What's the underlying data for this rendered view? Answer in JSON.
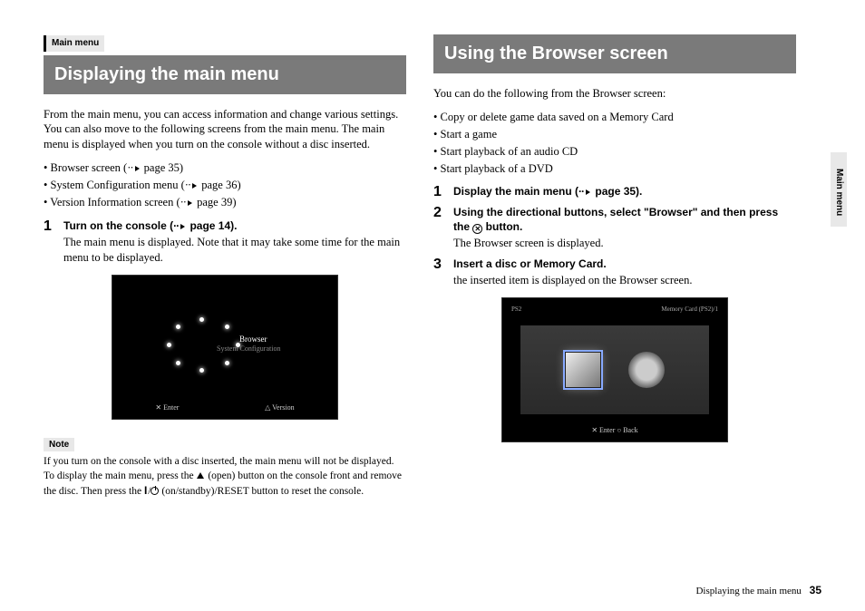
{
  "sideTabLabel": "Main menu",
  "left": {
    "sectionTag": "Main menu",
    "title": "Displaying the main menu",
    "intro": "From the main menu, you can access information and change various settings. You can also move to the following screens from the main menu. The main menu is displayed when you turn on the console without a disc inserted.",
    "bullets": [
      "Browser screen (  page 35)",
      "System Configuration menu (  page 36)",
      "Version Information screen (  page 39)"
    ],
    "steps": [
      {
        "num": "1",
        "title": "Turn on the console (  page 14).",
        "body": "The main menu is displayed. Note that it may take some time for the main menu to be displayed."
      }
    ],
    "shot": {
      "menuA": "Browser",
      "menuB": "System Configuration",
      "enter": "✕ Enter",
      "version": "△ Version"
    },
    "noteTag": "Note",
    "noteA": "If you turn on the console with a disc inserted, the main menu will not be displayed. To display the main menu, press the ",
    "noteB": " (open) button on the console front and remove the disc. Then press the ",
    "noteC": " (on/standby)/RESET button to reset the console."
  },
  "right": {
    "title": "Using the Browser screen",
    "intro": "You can do the following from the Browser screen:",
    "bullets": [
      "Copy or delete game data saved on a Memory Card",
      "Start a game",
      "Start playback of an audio CD",
      "Start playback of a DVD"
    ],
    "steps": [
      {
        "num": "1",
        "title": "Display the main menu (  page 35)."
      },
      {
        "num": "2",
        "titleA": "Using the directional buttons, select \"Browser\" and then press the ",
        "titleB": " button.",
        "body": "The Browser screen is displayed."
      },
      {
        "num": "3",
        "title": "Insert a disc or Memory Card.",
        "body": "the inserted item is displayed on the Browser screen."
      }
    ],
    "shot": {
      "topLeft": "PS2",
      "topRight": "Memory Card (PS2)/1",
      "bottom": "✕ Enter   ○ Back"
    }
  },
  "footer": {
    "text": "Displaying the main menu",
    "page": "35"
  }
}
